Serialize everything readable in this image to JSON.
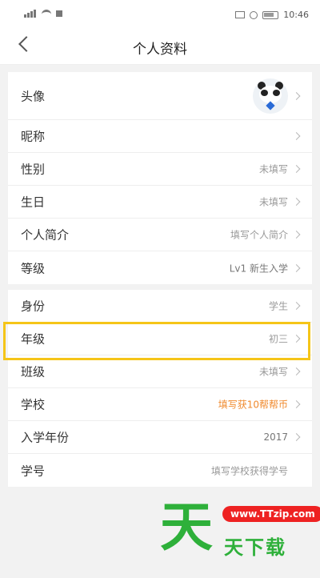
{
  "status_bar": {
    "time": "10:46"
  },
  "header": {
    "title": "个人资料"
  },
  "profile": {
    "rows": [
      {
        "label": "头像",
        "value": ""
      },
      {
        "label": "昵称",
        "value": ""
      },
      {
        "label": "性别",
        "value": "未填写"
      },
      {
        "label": "生日",
        "value": "未填写"
      },
      {
        "label": "个人简介",
        "value": "填写个人简介"
      },
      {
        "label": "等级",
        "value": "Lv1 新生入学"
      }
    ]
  },
  "school_info": {
    "rows": [
      {
        "label": "身份",
        "value": "学生"
      },
      {
        "label": "年级",
        "value": "初三"
      },
      {
        "label": "班级",
        "value": "未填写"
      },
      {
        "label": "学校",
        "value": "填写获10帮帮币"
      },
      {
        "label": "入学年份",
        "value": "2017"
      },
      {
        "label": "学号",
        "value": "填写学校获得学号"
      }
    ]
  },
  "colors": {
    "highlight": "#f5c518",
    "reward_text": "#f08a2e"
  },
  "watermark": {
    "big": "天",
    "url": "www.TTzip.com",
    "small": "天下载"
  }
}
